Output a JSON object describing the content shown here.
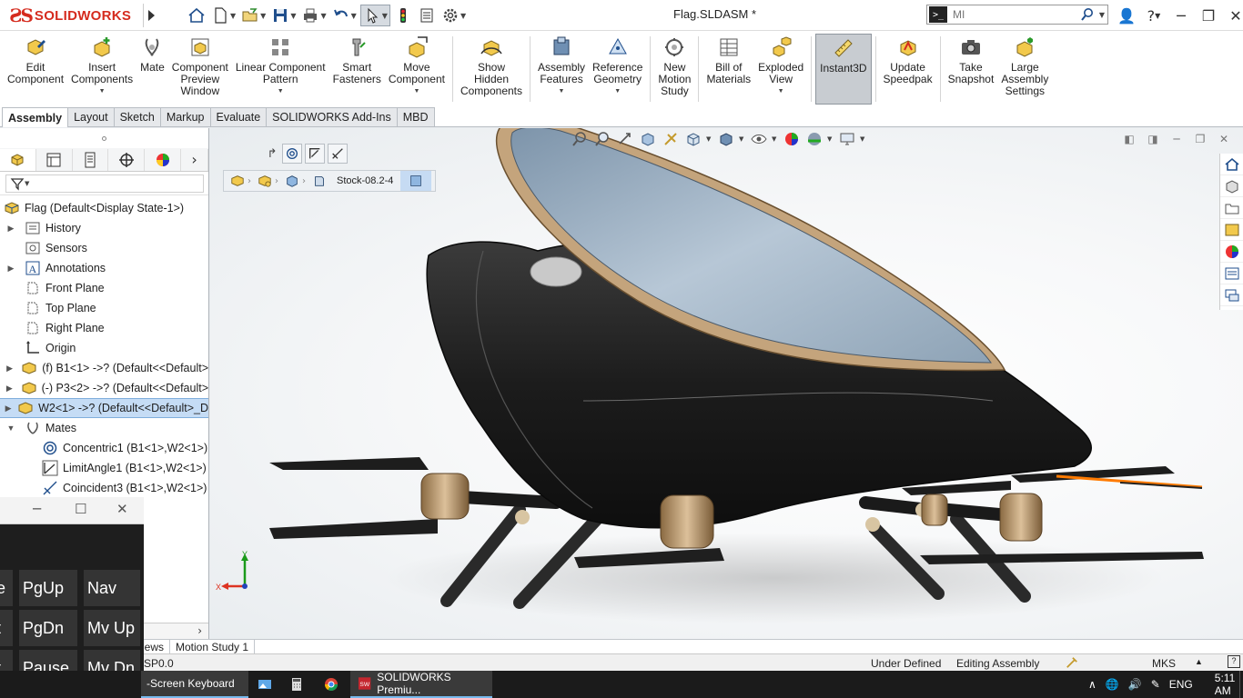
{
  "app": {
    "logo_text": "SOLIDWORKS",
    "document_title": "Flag.SLDASM *",
    "search_placeholder": "MI"
  },
  "ribbon": [
    {
      "label": "Edit\nComponent",
      "icon": "edit-component-icon"
    },
    {
      "label": "Insert\nComponents",
      "icon": "insert-components-icon",
      "dropdown": true
    },
    {
      "label": "Mate",
      "icon": "mate-icon"
    },
    {
      "label": "Component\nPreview\nWindow",
      "icon": "component-preview-icon"
    },
    {
      "label": "Linear Component\nPattern",
      "icon": "linear-pattern-icon",
      "dropdown": true
    },
    {
      "label": "Smart\nFasteners",
      "icon": "smart-fasteners-icon"
    },
    {
      "label": "Move\nComponent",
      "icon": "move-component-icon",
      "dropdown": true
    },
    {
      "label": "Show\nHidden\nComponents",
      "icon": "show-hidden-icon"
    },
    {
      "label": "Assembly\nFeatures",
      "icon": "assembly-features-icon",
      "dropdown": true
    },
    {
      "label": "Reference\nGeometry",
      "icon": "reference-geometry-icon",
      "dropdown": true
    },
    {
      "label": "New\nMotion\nStudy",
      "icon": "motion-study-icon"
    },
    {
      "label": "Bill of\nMaterials",
      "icon": "bom-icon"
    },
    {
      "label": "Exploded\nView",
      "icon": "exploded-view-icon",
      "dropdown": true
    },
    {
      "label": "Instant3D",
      "icon": "instant3d-icon",
      "selected": true
    },
    {
      "label": "Update\nSpeedpak",
      "icon": "speedpak-icon"
    },
    {
      "label": "Take\nSnapshot",
      "icon": "snapshot-icon"
    },
    {
      "label": "Large\nAssembly\nSettings",
      "icon": "large-assembly-icon"
    }
  ],
  "tabs": [
    "Assembly",
    "Layout",
    "Sketch",
    "Markup",
    "Evaluate",
    "SOLIDWORKS Add-Ins",
    "MBD"
  ],
  "active_tab": "Assembly",
  "tree": {
    "root": "Flag  (Default<Display State-1>)",
    "items": [
      {
        "label": "History",
        "icon": "history-icon",
        "expand": true
      },
      {
        "label": "Sensors",
        "icon": "sensors-icon"
      },
      {
        "label": "Annotations",
        "icon": "annotations-icon",
        "expand": true
      },
      {
        "label": "Front Plane",
        "icon": "plane-icon"
      },
      {
        "label": "Top Plane",
        "icon": "plane-icon"
      },
      {
        "label": "Right Plane",
        "icon": "plane-icon"
      },
      {
        "label": "Origin",
        "icon": "origin-icon"
      },
      {
        "label": "(f) B1<1> ->? (Default<<Default>",
        "icon": "part-icon",
        "expand": true
      },
      {
        "label": "(-) P3<2> ->? (Default<<Default>",
        "icon": "part-icon",
        "expand": true
      },
      {
        "label": "W2<1> ->? (Default<<Default>_D",
        "icon": "part-icon",
        "expand": true,
        "selected": true
      },
      {
        "label": "Mates",
        "icon": "mates-icon",
        "expand": true,
        "expanded": true
      },
      {
        "label": "Concentric1 (B1<1>,W2<1>)",
        "icon": "concentric-icon",
        "indent": true
      },
      {
        "label": "LimitAngle1 (B1<1>,W2<1>)",
        "icon": "limit-angle-icon",
        "indent": true
      },
      {
        "label": "Coincident3 (B1<1>,W2<1>)",
        "icon": "coincident-icon",
        "indent": true
      }
    ]
  },
  "breadcrumb": {
    "text": "Stock-08.2-4"
  },
  "model_tabs": [
    "iews",
    "Motion Study 1"
  ],
  "status": {
    "left": "SP0.0",
    "defined": "Under Defined",
    "mode": "Editing Assembly",
    "units": "MKS"
  },
  "keyboard": {
    "keys": [
      "e",
      "PgUp",
      "Nav",
      "t",
      "PgDn",
      "Mv Up",
      "t",
      "Pause",
      "Mv Dn"
    ]
  },
  "taskbar": {
    "osk_label": "-Screen Keyboard",
    "app_label": "SOLIDWORKS Premiu...",
    "lang": "ENG",
    "time": "5:11 AM"
  },
  "colors": {
    "brand": "#d52b1e",
    "selection": "#c5dcf5",
    "body_black": "#1a1a1a",
    "canopy": "#a9bccd",
    "trim": "#c4a47c",
    "accent_orange": "#ff7a00"
  }
}
